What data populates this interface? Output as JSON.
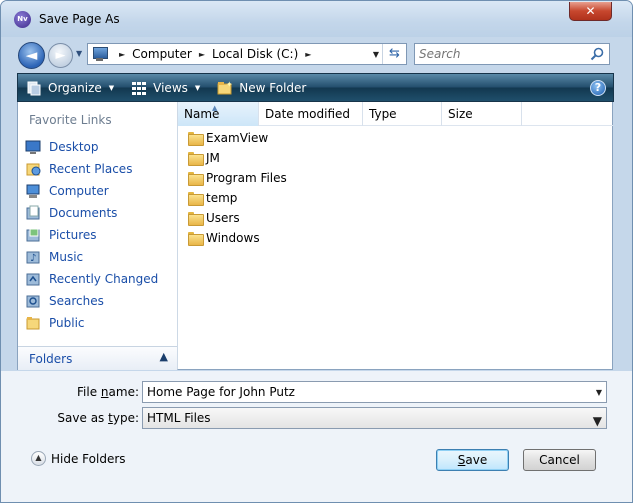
{
  "window": {
    "title": "Save Page As",
    "close_label": "✕",
    "app_icon_text": "Nv"
  },
  "nav": {
    "back_glyph": "◄",
    "forward_glyph": "►",
    "breadcrumb": [
      "Computer",
      "Local Disk (C:)"
    ],
    "search_placeholder": "Search"
  },
  "toolbar": {
    "organize_label": "Organize",
    "views_label": "Views",
    "new_folder_label": "New Folder",
    "help_label": "?"
  },
  "sidebar": {
    "heading": "Favorite Links",
    "items": [
      {
        "label": "Desktop",
        "icon": "desktop-icon"
      },
      {
        "label": "Recent Places",
        "icon": "recent-places-icon"
      },
      {
        "label": "Computer",
        "icon": "computer-icon"
      },
      {
        "label": "Documents",
        "icon": "documents-icon"
      },
      {
        "label": "Pictures",
        "icon": "pictures-icon"
      },
      {
        "label": "Music",
        "icon": "music-icon"
      },
      {
        "label": "Recently Changed",
        "icon": "recently-changed-icon"
      },
      {
        "label": "Searches",
        "icon": "searches-icon"
      },
      {
        "label": "Public",
        "icon": "public-icon"
      }
    ],
    "folders_label": "Folders"
  },
  "file_list": {
    "columns": [
      "Name",
      "Date modified",
      "Type",
      "Size"
    ],
    "sorted_column": "Name",
    "rows": [
      {
        "name": "ExamView"
      },
      {
        "name": "JM"
      },
      {
        "name": "Program Files"
      },
      {
        "name": "temp"
      },
      {
        "name": "Users"
      },
      {
        "name": "Windows"
      }
    ]
  },
  "form": {
    "file_name_label_pre": "File ",
    "file_name_label_u": "n",
    "file_name_label_post": "ame:",
    "file_name_value": "Home Page for John Putz",
    "save_type_label_pre": "Save as ",
    "save_type_label_u": "t",
    "save_type_label_post": "ype:",
    "save_type_value": "HTML Files"
  },
  "footer": {
    "hide_folders_label": "Hide Folders",
    "save_label_u": "S",
    "save_label_rest": "ave",
    "cancel_label": "Cancel"
  },
  "colors": {
    "toolbar": "#1f4f6b",
    "link": "#1a4ea8",
    "frame": "#c5d7ea"
  }
}
